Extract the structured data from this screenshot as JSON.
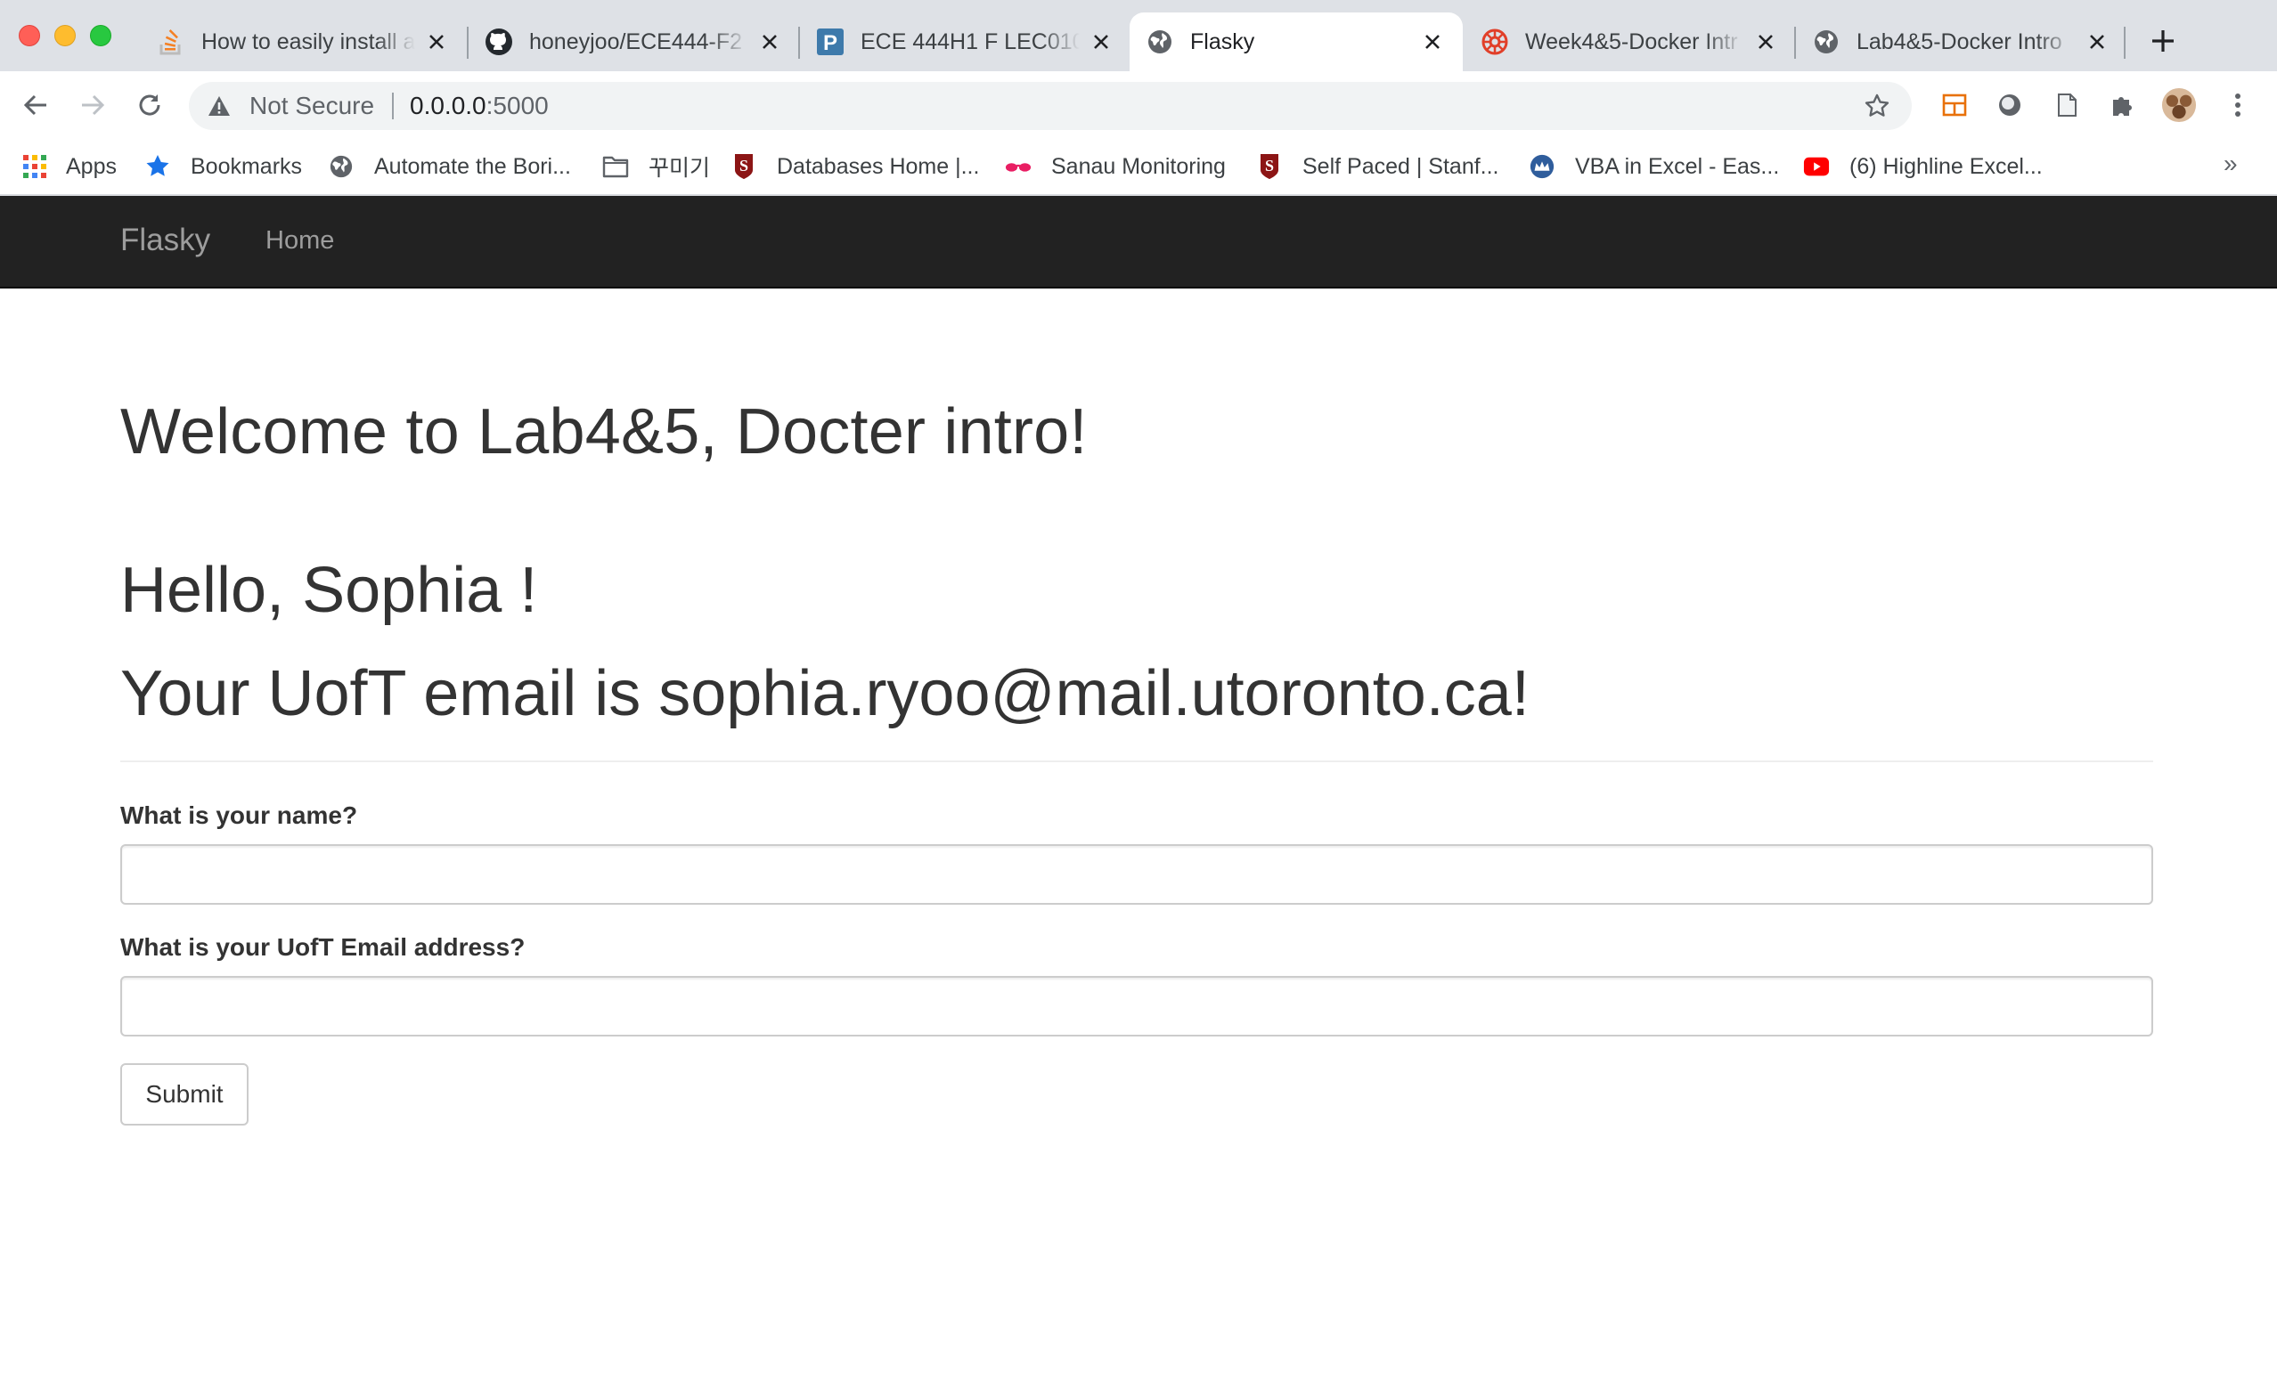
{
  "browser": {
    "tabs": [
      {
        "title": "How to easily install a",
        "favicon": "stackoverflow-icon",
        "active": false
      },
      {
        "title": "honeyjoo/ECE444-F2",
        "favicon": "github-icon",
        "active": false
      },
      {
        "title": "ECE 444H1 F LEC010",
        "favicon": "piazza-icon",
        "active": false
      },
      {
        "title": "Flasky",
        "favicon": "globe-icon",
        "active": true
      },
      {
        "title": "Week4&5-Docker Intr",
        "favicon": "quercus-icon",
        "active": false
      },
      {
        "title": "Lab4&5-Docker Intro",
        "favicon": "globe-icon",
        "active": false
      }
    ],
    "address_bar": {
      "security_label": "Not Secure",
      "host": "0.0.0.0",
      "port": ":5000"
    },
    "bookmarks": [
      {
        "label": "Apps",
        "icon": "apps-grid-icon"
      },
      {
        "label": "Bookmarks",
        "icon": "star-icon"
      },
      {
        "label": "Automate the Bori...",
        "icon": "globe-icon"
      },
      {
        "label": "꾸미기",
        "icon": "folder-icon"
      },
      {
        "label": "Databases Home |...",
        "icon": "stanford-icon"
      },
      {
        "label": "Sanau Monitoring",
        "icon": "glasses-icon"
      },
      {
        "label": "Self Paced | Stanf...",
        "icon": "stanford-icon"
      },
      {
        "label": "VBA in Excel - Eas...",
        "icon": "crown-icon"
      },
      {
        "label": "(6) Highline Excel...",
        "icon": "youtube-icon"
      }
    ],
    "bookmarks_more": "»",
    "colors": {
      "tabstrip": "#dee1e6",
      "omnibox": "#f1f3f4"
    }
  },
  "page": {
    "navbar": {
      "brand": "Flasky",
      "links": [
        "Home"
      ]
    },
    "welcome": "Welcome to Lab4&5, Docter intro!",
    "greeting": "Hello, Sophia !",
    "email_line": "Your UofT email is sophia.ryoo@mail.utoronto.ca!",
    "form": {
      "name_label": "What is your name?",
      "name_value": "",
      "email_label": "What is your UofT Email address?",
      "email_value": "",
      "submit_label": "Submit"
    },
    "colors": {
      "navbar_bg": "#222222",
      "navbar_text": "#9d9d9d",
      "text": "#333333"
    }
  }
}
